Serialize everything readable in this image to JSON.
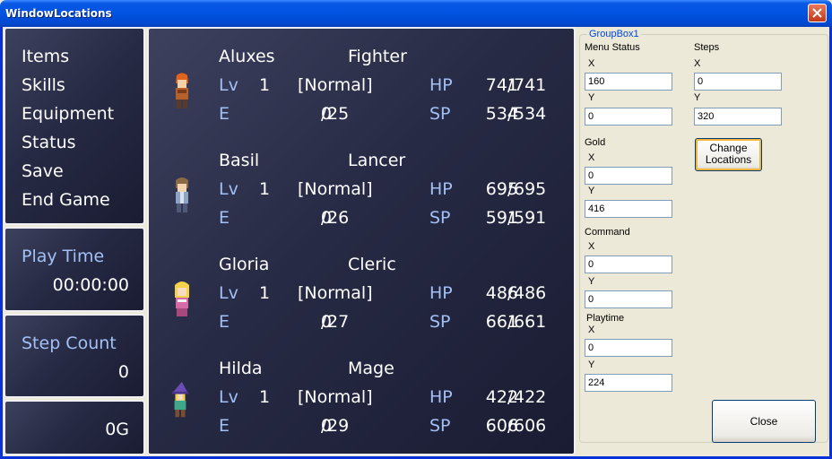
{
  "window": {
    "title": "WindowLocations"
  },
  "menu": {
    "items": [
      "Items",
      "Skills",
      "Equipment",
      "Status",
      "Save",
      "End Game"
    ]
  },
  "playtime": {
    "label": "Play Time",
    "value": "00:00:00"
  },
  "steps": {
    "label": "Step Count",
    "value": "0"
  },
  "gold": {
    "value": "0G"
  },
  "party": [
    {
      "name": "Aluxes",
      "class": "Fighter",
      "lv_label": "Lv",
      "level": "1",
      "state": "[Normal]",
      "hp_label": "HP",
      "hp": "741",
      "hp_max": "741",
      "e_label": "E",
      "exp": "0",
      "exp_next": "25",
      "sp_label": "SP",
      "sp": "534",
      "sp_max": "534",
      "sprite": "fighter-sprite-icon"
    },
    {
      "name": "Basil",
      "class": "Lancer",
      "lv_label": "Lv",
      "level": "1",
      "state": "[Normal]",
      "hp_label": "HP",
      "hp": "695",
      "hp_max": "695",
      "e_label": "E",
      "exp": "0",
      "exp_next": "26",
      "sp_label": "SP",
      "sp": "591",
      "sp_max": "591",
      "sprite": "lancer-sprite-icon"
    },
    {
      "name": "Gloria",
      "class": "Cleric",
      "lv_label": "Lv",
      "level": "1",
      "state": "[Normal]",
      "hp_label": "HP",
      "hp": "486",
      "hp_max": "486",
      "e_label": "E",
      "exp": "0",
      "exp_next": "27",
      "sp_label": "SP",
      "sp": "661",
      "sp_max": "661",
      "sprite": "cleric-sprite-icon"
    },
    {
      "name": "Hilda",
      "class": "Mage",
      "lv_label": "Lv",
      "level": "1",
      "state": "[Normal]",
      "hp_label": "HP",
      "hp": "422",
      "hp_max": "422",
      "e_label": "E",
      "exp": "0",
      "exp_next": "29",
      "sp_label": "SP",
      "sp": "606",
      "sp_max": "606",
      "sprite": "mage-sprite-icon"
    }
  ],
  "groupbox": {
    "legend": "GroupBox1",
    "menu_status": {
      "label": "Menu Status",
      "x_label": "X",
      "x": "160",
      "y_label": "Y",
      "y": "0"
    },
    "steps": {
      "label": "Steps",
      "x_label": "X",
      "x": "0",
      "y_label": "Y",
      "y": "320"
    },
    "gold": {
      "label": "Gold",
      "x_label": "X",
      "x": "0",
      "y_label": "Y",
      "y": "416"
    },
    "command": {
      "label": "Command",
      "x_label": "X",
      "x": "0",
      "y_label": "Y",
      "y": "0"
    },
    "playtime": {
      "label": "Playtime",
      "x_label": "X",
      "x": "0",
      "y_label": "Y",
      "y": "224"
    },
    "change_button": "Change\nLocations",
    "close_button": "Close"
  },
  "colors": {
    "titlebar": "#0052e0",
    "system_text": "#a2c0f5",
    "legend": "#0046d5",
    "button_focus": "#f2b43a"
  }
}
